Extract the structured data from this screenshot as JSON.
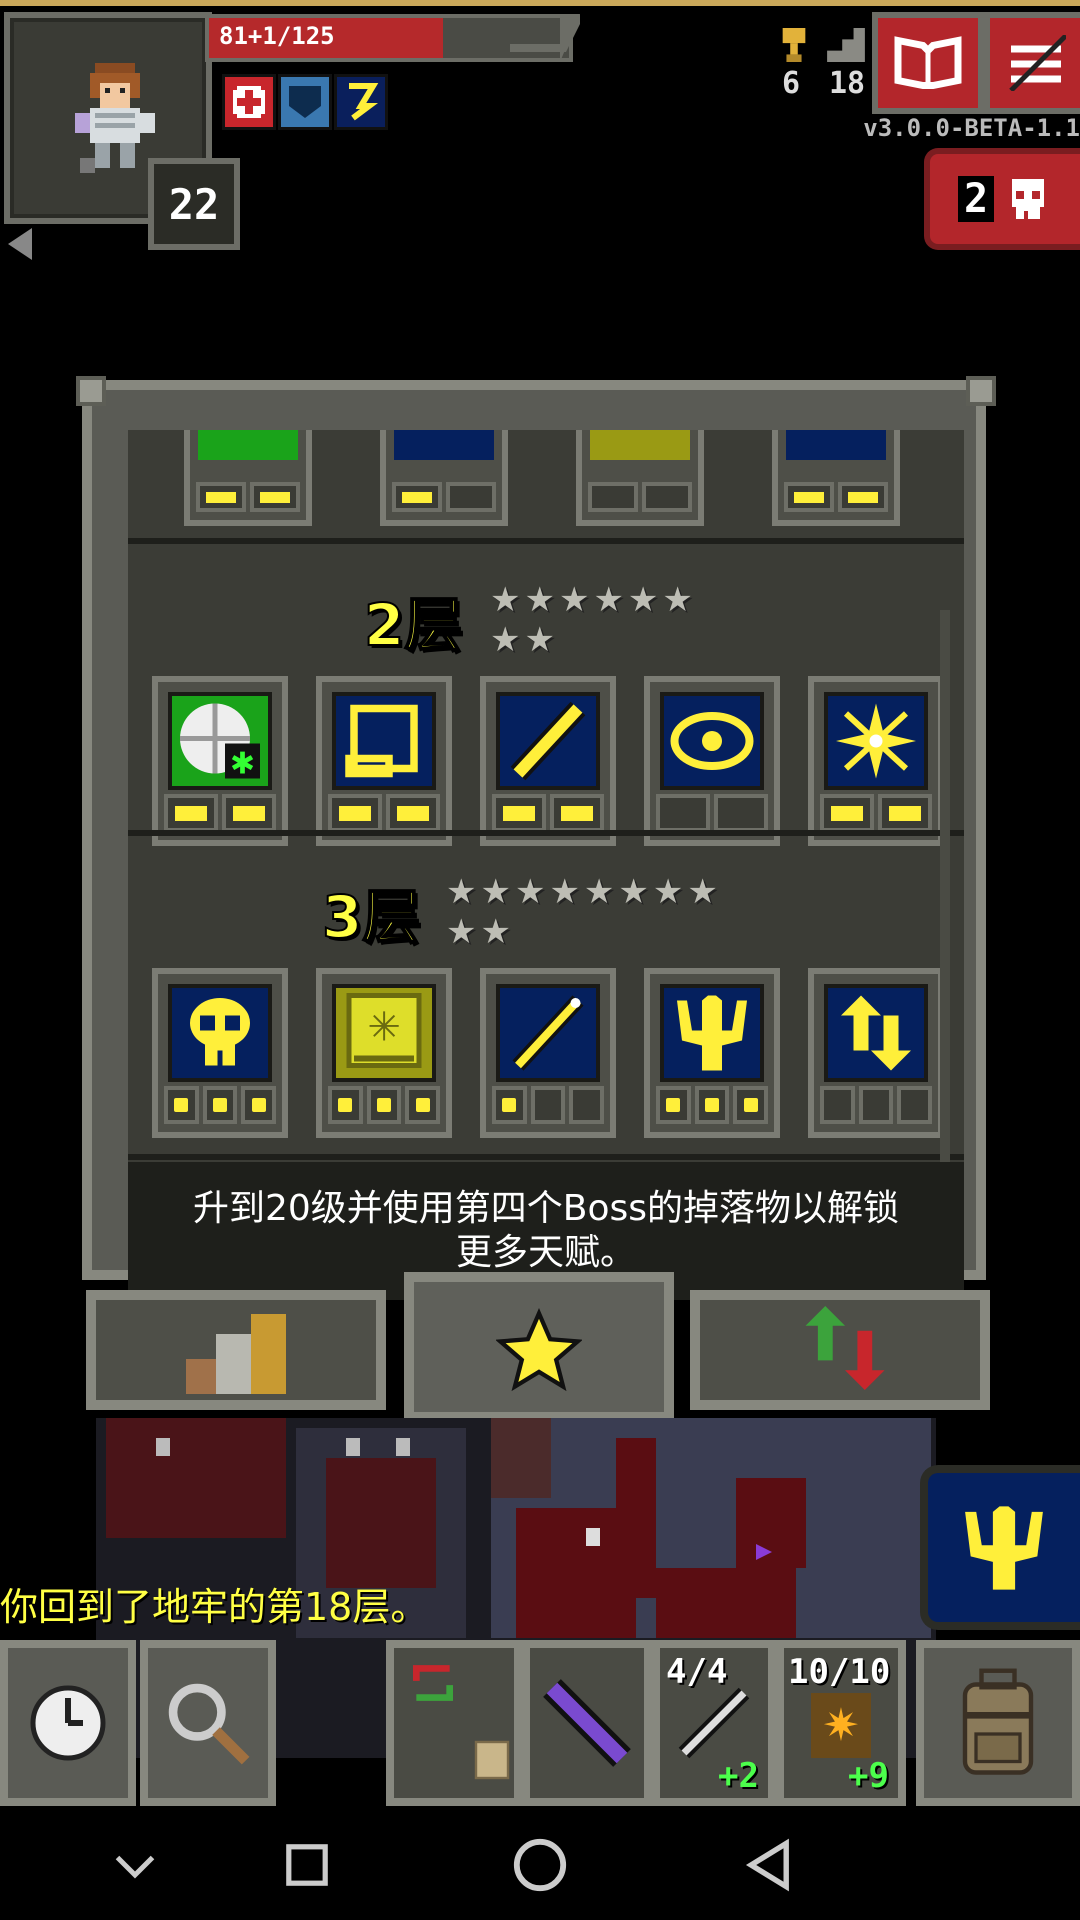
{
  "hud": {
    "hp_text": "81+1/125",
    "hp_fraction": 0.65,
    "hero_level": "22",
    "gold_count": "6",
    "depth_count": "18",
    "version": "v3.0.0-BETA-1.1",
    "danger_count": "2",
    "buff_icons": [
      "first-aid-buff-icon",
      "shield-buff-icon",
      "fury-buff-icon"
    ],
    "buttons": [
      "journal-button",
      "menu-button"
    ]
  },
  "talents": {
    "tier2": {
      "title": "2层",
      "stars": "★★★★★★",
      "stars2": "★★",
      "items": [
        {
          "icon": "white-shield-icon",
          "points": [
            1,
            1
          ]
        },
        {
          "icon": "scroll-icon",
          "points": [
            1,
            1
          ]
        },
        {
          "icon": "wand-icon",
          "points": [
            1,
            1
          ]
        },
        {
          "icon": "eye-icon",
          "points": [
            0,
            0
          ]
        },
        {
          "icon": "sparkle-icon",
          "points": [
            1,
            1
          ]
        }
      ]
    },
    "tier3": {
      "title": "3层",
      "stars": "★★★★★★★★",
      "stars2": "★★",
      "items": [
        {
          "icon": "skull-icon",
          "points": [
            1,
            1,
            1
          ]
        },
        {
          "icon": "spellbook-icon",
          "points": [
            1,
            1,
            1
          ]
        },
        {
          "icon": "magic-staff-icon",
          "points": [
            1,
            0,
            0
          ]
        },
        {
          "icon": "trident-icon",
          "points": [
            1,
            1,
            1
          ]
        },
        {
          "icon": "swap-arrows-icon",
          "points": [
            0,
            0,
            0
          ]
        }
      ]
    },
    "hint_line1": "升到20级并使用第四个Boss的掉落物以解锁",
    "hint_line2": "更多天赋。"
  },
  "tabs": [
    "stats-tab",
    "talents-tab",
    "upgrades-tab"
  ],
  "log_message": "你回到了地牢的第18层。",
  "quickslots": {
    "wand_charges": "4/4",
    "wand_level": "+2",
    "artifact_charges": "10/10",
    "artifact_level": "+9"
  }
}
